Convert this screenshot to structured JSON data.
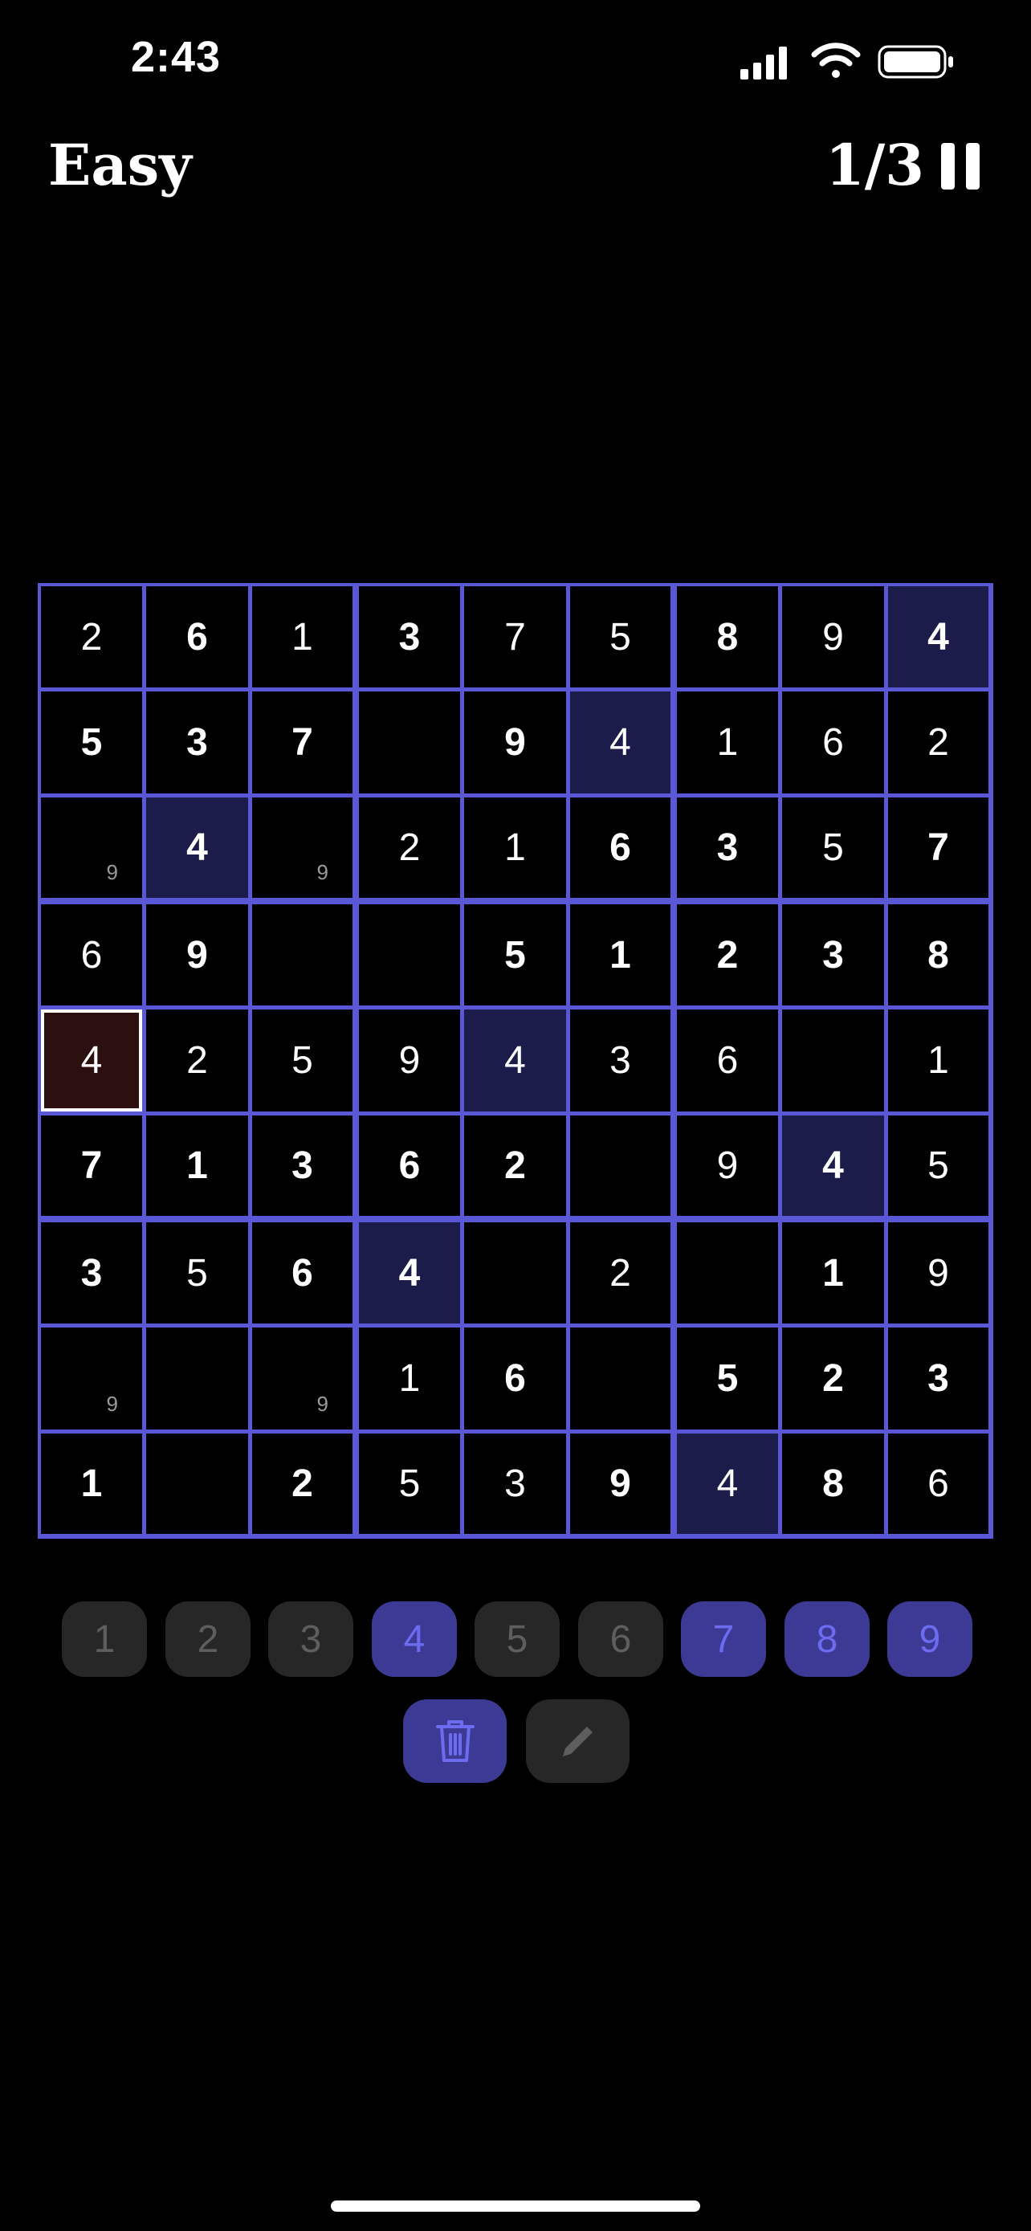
{
  "status": {
    "time": "2:43"
  },
  "header": {
    "title": "Easy",
    "progress": "1/3"
  },
  "board": {
    "cells": [
      [
        {
          "v": "2",
          "t": "user"
        },
        {
          "v": "6",
          "t": "given"
        },
        {
          "v": "1",
          "t": "user"
        },
        {
          "v": "3",
          "t": "given"
        },
        {
          "v": "7",
          "t": "user"
        },
        {
          "v": "5",
          "t": "user"
        },
        {
          "v": "8",
          "t": "given"
        },
        {
          "v": "9",
          "t": "user"
        },
        {
          "v": "4",
          "t": "given",
          "hl": true
        }
      ],
      [
        {
          "v": "5",
          "t": "given"
        },
        {
          "v": "3",
          "t": "given"
        },
        {
          "v": "7",
          "t": "given"
        },
        {
          "v": "",
          "t": "empty"
        },
        {
          "v": "9",
          "t": "given"
        },
        {
          "v": "4",
          "t": "user",
          "hl": true
        },
        {
          "v": "1",
          "t": "user"
        },
        {
          "v": "6",
          "t": "user"
        },
        {
          "v": "2",
          "t": "user"
        }
      ],
      [
        {
          "v": "",
          "t": "empty",
          "note": "9"
        },
        {
          "v": "4",
          "t": "given",
          "hl": true
        },
        {
          "v": "",
          "t": "empty",
          "note": "9"
        },
        {
          "v": "2",
          "t": "user"
        },
        {
          "v": "1",
          "t": "user"
        },
        {
          "v": "6",
          "t": "given"
        },
        {
          "v": "3",
          "t": "given"
        },
        {
          "v": "5",
          "t": "user"
        },
        {
          "v": "7",
          "t": "given"
        }
      ],
      [
        {
          "v": "6",
          "t": "user"
        },
        {
          "v": "9",
          "t": "given"
        },
        {
          "v": "",
          "t": "empty"
        },
        {
          "v": "",
          "t": "empty"
        },
        {
          "v": "5",
          "t": "given"
        },
        {
          "v": "1",
          "t": "given"
        },
        {
          "v": "2",
          "t": "given"
        },
        {
          "v": "3",
          "t": "given"
        },
        {
          "v": "8",
          "t": "given"
        }
      ],
      [
        {
          "v": "4",
          "t": "user",
          "selected": true
        },
        {
          "v": "2",
          "t": "user"
        },
        {
          "v": "5",
          "t": "user"
        },
        {
          "v": "9",
          "t": "user"
        },
        {
          "v": "4",
          "t": "user",
          "hl": true
        },
        {
          "v": "3",
          "t": "user"
        },
        {
          "v": "6",
          "t": "user"
        },
        {
          "v": "",
          "t": "empty"
        },
        {
          "v": "1",
          "t": "user"
        }
      ],
      [
        {
          "v": "7",
          "t": "given"
        },
        {
          "v": "1",
          "t": "given"
        },
        {
          "v": "3",
          "t": "given"
        },
        {
          "v": "6",
          "t": "given"
        },
        {
          "v": "2",
          "t": "given"
        },
        {
          "v": "",
          "t": "empty"
        },
        {
          "v": "9",
          "t": "user"
        },
        {
          "v": "4",
          "t": "given",
          "hl": true
        },
        {
          "v": "5",
          "t": "user"
        }
      ],
      [
        {
          "v": "3",
          "t": "given"
        },
        {
          "v": "5",
          "t": "user"
        },
        {
          "v": "6",
          "t": "given"
        },
        {
          "v": "4",
          "t": "given",
          "hl": true
        },
        {
          "v": "",
          "t": "empty"
        },
        {
          "v": "2",
          "t": "user"
        },
        {
          "v": "",
          "t": "empty"
        },
        {
          "v": "1",
          "t": "given"
        },
        {
          "v": "9",
          "t": "user"
        }
      ],
      [
        {
          "v": "",
          "t": "empty",
          "note": "9"
        },
        {
          "v": "",
          "t": "empty"
        },
        {
          "v": "",
          "t": "empty",
          "note": "9"
        },
        {
          "v": "1",
          "t": "user"
        },
        {
          "v": "6",
          "t": "given"
        },
        {
          "v": "",
          "t": "empty"
        },
        {
          "v": "5",
          "t": "given"
        },
        {
          "v": "2",
          "t": "given"
        },
        {
          "v": "3",
          "t": "given"
        }
      ],
      [
        {
          "v": "1",
          "t": "given"
        },
        {
          "v": "",
          "t": "empty"
        },
        {
          "v": "2",
          "t": "given"
        },
        {
          "v": "5",
          "t": "user"
        },
        {
          "v": "3",
          "t": "user"
        },
        {
          "v": "9",
          "t": "given"
        },
        {
          "v": "4",
          "t": "user",
          "hl": true
        },
        {
          "v": "8",
          "t": "given"
        },
        {
          "v": "6",
          "t": "user"
        }
      ]
    ]
  },
  "numpad": [
    {
      "label": "1",
      "active": false
    },
    {
      "label": "2",
      "active": false
    },
    {
      "label": "3",
      "active": false
    },
    {
      "label": "4",
      "active": true
    },
    {
      "label": "5",
      "active": false
    },
    {
      "label": "6",
      "active": false
    },
    {
      "label": "7",
      "active": true
    },
    {
      "label": "8",
      "active": true
    },
    {
      "label": "9",
      "active": true
    }
  ],
  "tools": {
    "delete_icon": "trash-icon",
    "pencil_icon": "pencil-icon"
  },
  "colors": {
    "accent": "#5b58d8",
    "highlight": "#1b1c4a",
    "selected": "#2c0f0f",
    "active_button": "#3c3a94"
  }
}
